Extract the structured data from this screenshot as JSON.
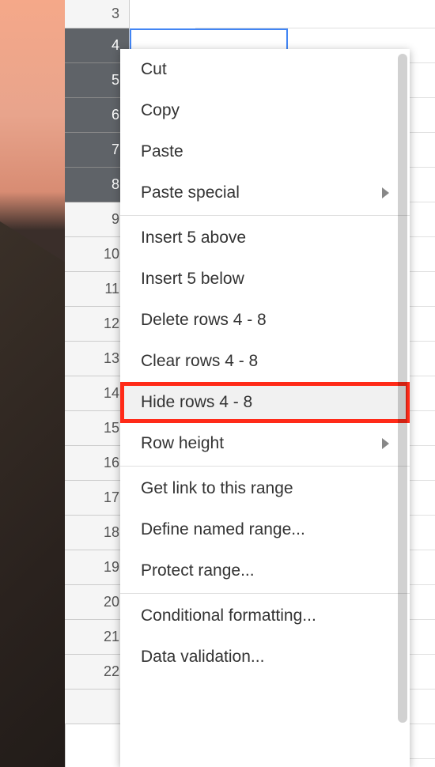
{
  "rows": {
    "visible": [
      "3",
      "4",
      "5",
      "6",
      "7",
      "8",
      "9",
      "10",
      "11",
      "12",
      "13",
      "14",
      "15",
      "16",
      "17",
      "18",
      "19",
      "20",
      "21",
      "22"
    ],
    "selected": [
      "4",
      "5",
      "6",
      "7",
      "8"
    ]
  },
  "menu": {
    "cut": "Cut",
    "copy": "Copy",
    "paste": "Paste",
    "paste_special": "Paste special",
    "insert_above": "Insert 5 above",
    "insert_below": "Insert 5 below",
    "delete_rows": "Delete rows 4 - 8",
    "clear_rows": "Clear rows 4 - 8",
    "hide_rows": "Hide rows 4 - 8",
    "row_height": "Row height",
    "get_link": "Get link to this range",
    "named_range": "Define named range...",
    "protect_range": "Protect range...",
    "conditional_formatting": "Conditional formatting...",
    "data_validation": "Data validation..."
  }
}
